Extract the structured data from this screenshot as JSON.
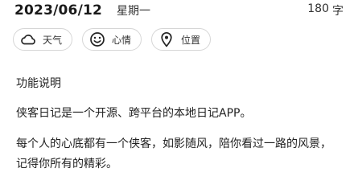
{
  "header": {
    "date": "2023/06/12",
    "weekday": "星期一",
    "word_count": "180",
    "word_unit": "字"
  },
  "chips": [
    {
      "label": "天气",
      "icon": "cloud-icon"
    },
    {
      "label": "心情",
      "icon": "smiley-icon"
    },
    {
      "label": "位置",
      "icon": "location-pin-icon"
    }
  ],
  "content": {
    "heading": "功能说明",
    "paragraph1": "侠客日记是一个开源、跨平台的本地日记APP。",
    "paragraph2": "每个人的心底都有一个侠客，如影随风，陪你看过一路的风景，记得你所有的精彩。"
  }
}
